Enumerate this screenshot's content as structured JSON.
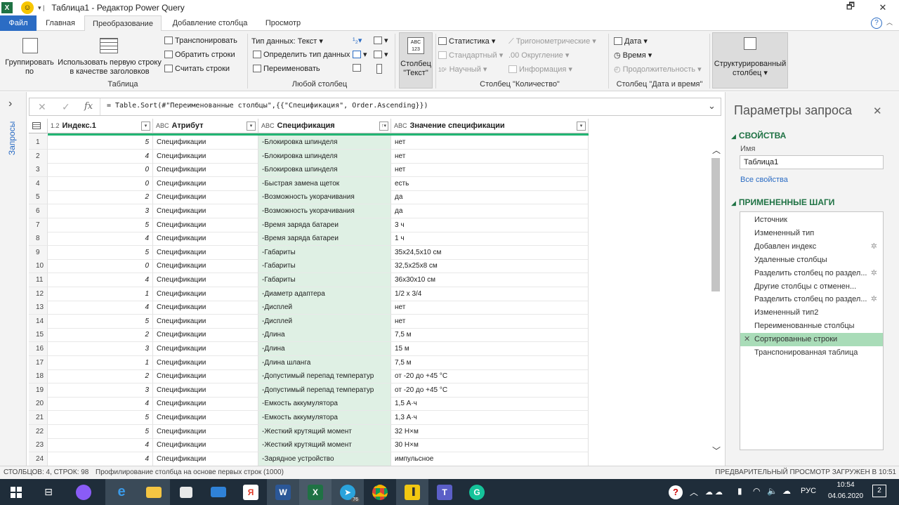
{
  "window": {
    "app_icon": "X",
    "title": "Таблица1 - Редактор Power Query",
    "restore": "🗗",
    "close": "✕"
  },
  "tabs": [
    "Файл",
    "Главная",
    "Преобразование",
    "Добавление столбца",
    "Просмотр"
  ],
  "help": "?",
  "ribbon": {
    "group_table": {
      "label": "Таблица",
      "group_by": "Группировать по",
      "use_first_row": "Использовать первую строку в качестве заголовков",
      "transpose": "Транспонировать",
      "reverse_rows": "Обратить строки",
      "count_rows": "Считать строки"
    },
    "group_any_column": {
      "label": "Любой столбец",
      "data_type": "Тип данных: Текст",
      "detect_type": "Определить тип данных",
      "rename": "Переименовать"
    },
    "text_column": "Столбец \"Текст\"",
    "group_number": {
      "label": "Столбец \"Количество\"",
      "statistics": "Статистика",
      "standard": "Стандартный",
      "scientific": "Научный",
      "trig": "Тригонометрические",
      "rounding": "Округление",
      "information": "Информация"
    },
    "group_date": {
      "label": "Столбец \"Дата и время\"",
      "date": "Дата",
      "time": "Время",
      "duration": "Продолжительность"
    },
    "structured": "Структурированный столбец"
  },
  "left_pane": {
    "queries_label": "Запросы",
    "expand": "›"
  },
  "formula_bar": {
    "cancel": "✕",
    "confirm": "✓",
    "fx": "fx",
    "text": "= Table.Sort(#\"Переименованные столбцы\",{{\"Спецификация\", Order.Ascending}})"
  },
  "grid": {
    "columns": [
      {
        "type": "1.2",
        "name": "Индекс.1"
      },
      {
        "type": "ABC",
        "name": "Атрибут"
      },
      {
        "type": "ABC",
        "name": "Спецификация"
      },
      {
        "type": "ABC",
        "name": "Значение спецификации"
      }
    ],
    "rows": [
      [
        "5",
        "Спецификации",
        "-Блокировка шпинделя",
        "нет"
      ],
      [
        "4",
        "Спецификации",
        "-Блокировка шпинделя",
        "нет"
      ],
      [
        "0",
        "Спецификации",
        "-Блокировка шпинделя",
        "нет"
      ],
      [
        "0",
        "Спецификации",
        "-Быстрая замена щеток",
        "есть"
      ],
      [
        "2",
        "Спецификации",
        "-Возможность укорачивания",
        "да"
      ],
      [
        "3",
        "Спецификации",
        "-Возможность укорачивания",
        "да"
      ],
      [
        "5",
        "Спецификации",
        "-Время заряда батареи",
        "3 ч"
      ],
      [
        "4",
        "Спецификации",
        "-Время заряда батареи",
        "1 ч"
      ],
      [
        "5",
        "Спецификации",
        "-Габариты",
        "35х24,5х10 см"
      ],
      [
        "0",
        "Спецификации",
        "-Габариты",
        "32,5х25х8 см"
      ],
      [
        "4",
        "Спецификации",
        "-Габариты",
        "36х30х10 см"
      ],
      [
        "1",
        "Спецификации",
        "-Диаметр адаптера",
        "1/2 x 3/4"
      ],
      [
        "4",
        "Спецификации",
        "-Дисплей",
        "нет"
      ],
      [
        "5",
        "Спецификации",
        "-Дисплей",
        "нет"
      ],
      [
        "2",
        "Спецификации",
        "-Длина",
        "7,5 м"
      ],
      [
        "3",
        "Спецификации",
        "-Длина",
        "15 м"
      ],
      [
        "1",
        "Спецификации",
        "-Длина шланга",
        "7,5 м"
      ],
      [
        "2",
        "Спецификации",
        "-Допустимый перепад температур",
        "от -20 до +45 °С"
      ],
      [
        "3",
        "Спецификации",
        "-Допустимый перепад температур",
        "от -20 до +45 °С"
      ],
      [
        "4",
        "Спецификации",
        "-Емкость аккумулятора",
        "1,5 А·ч"
      ],
      [
        "5",
        "Спецификации",
        "-Емкость аккумулятора",
        "1,3 А·ч"
      ],
      [
        "5",
        "Спецификации",
        "-Жесткий крутящий момент",
        "32 Н×м"
      ],
      [
        "4",
        "Спецификации",
        "-Жесткий крутящий момент",
        "30 Н×м"
      ],
      [
        "4",
        "Спецификации",
        "-Зарядное устройство",
        "импульсное"
      ]
    ]
  },
  "query_settings": {
    "title": "Параметры запроса",
    "close": "✕",
    "properties_header": "СВОЙСТВА",
    "name_label": "Имя",
    "name_value": "Таблица1",
    "all_properties": "Все свойства",
    "steps_header": "ПРИМЕНЕННЫЕ ШАГИ",
    "steps": [
      {
        "label": "Источник",
        "gear": false
      },
      {
        "label": "Измененный тип",
        "gear": false
      },
      {
        "label": "Добавлен индекс",
        "gear": true
      },
      {
        "label": "Удаленные столбцы",
        "gear": false
      },
      {
        "label": "Разделить столбец по раздел...",
        "gear": true
      },
      {
        "label": "Другие столбцы с отменен...",
        "gear": false
      },
      {
        "label": "Разделить столбец по раздел...",
        "gear": true
      },
      {
        "label": "Измененный тип2",
        "gear": false
      },
      {
        "label": "Переименованные столбцы",
        "gear": false
      },
      {
        "label": "Сортированные строки",
        "gear": false,
        "selected": true
      },
      {
        "label": "Транспонированная таблица",
        "gear": false
      }
    ]
  },
  "status": {
    "left": "СТОЛБЦОВ: 4, СТРОК: 98",
    "profiling": "Профилирование столбца на основе первых строк (1000)",
    "right": "ПРЕДВАРИТЕЛЬНЫЙ ПРОСМОТР ЗАГРУЖЕН В 10:51"
  },
  "taskbar": {
    "lang": "РУС",
    "time": "10:54",
    "date": "04.06.2020",
    "notifications": "2",
    "telegram_badge": "76"
  },
  "colors": {
    "accent": "#2b6cc4",
    "excel_green": "#1f7244",
    "selected_step": "#a9dcb8",
    "quality_bar": "#22b573"
  }
}
